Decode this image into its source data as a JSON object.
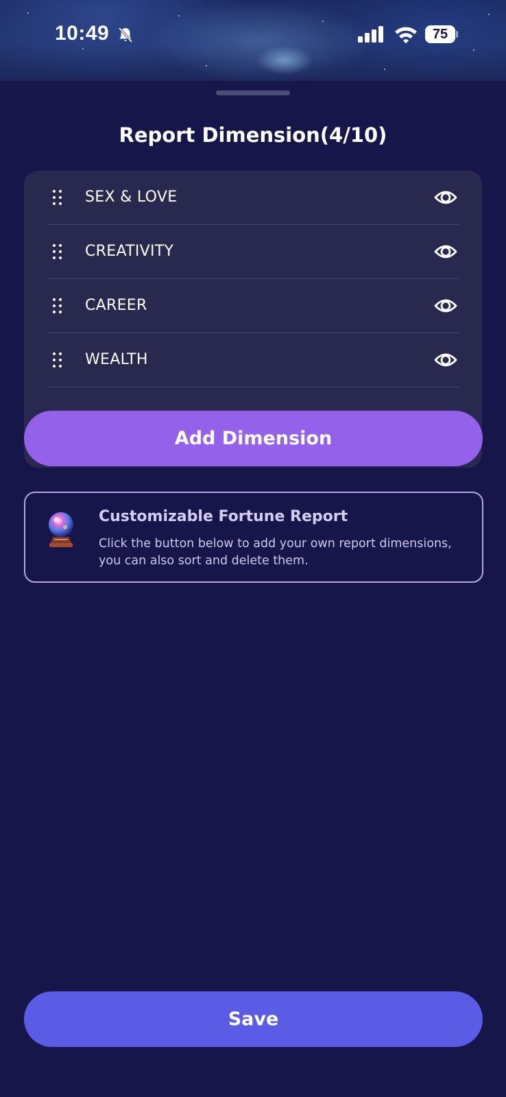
{
  "status_bar": {
    "time": "10:49",
    "battery_level": "75",
    "battery_fraction": 0.75,
    "icons": [
      "bell-slash-icon",
      "cellular-signal-icon",
      "wifi-icon",
      "battery-icon"
    ]
  },
  "sheet": {
    "title": "Report Dimension(4/10)",
    "dimensions": [
      {
        "label": "SEX & LOVE",
        "visible": true,
        "icon": "eye-icon"
      },
      {
        "label": "CREATIVITY",
        "visible": true,
        "icon": "eye-icon"
      },
      {
        "label": "CAREER",
        "visible": true,
        "icon": "eye-icon"
      },
      {
        "label": "WEALTH",
        "visible": true,
        "icon": "eye-icon"
      }
    ],
    "add_button_label": "Add Dimension",
    "info": {
      "icon": "crystal-ball-icon",
      "title": "Customizable Fortune Report",
      "body": "Click the button below to add your own report dimensions, you can also sort and delete them."
    },
    "save_button_label": "Save"
  },
  "colors": {
    "background": "#17164a",
    "list_background": "#29284f",
    "add_button": "#9462ea",
    "save_button": "#5a5ce6",
    "info_border": "#b3a9e6"
  }
}
